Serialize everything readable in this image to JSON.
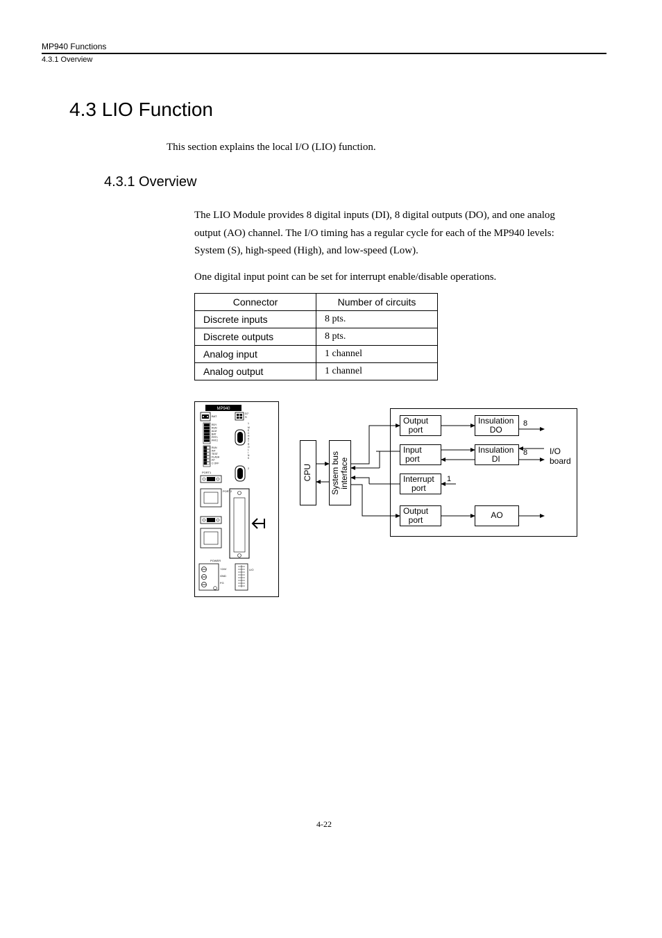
{
  "header": {
    "doc_title": "MP940 Functions",
    "running": "4.3.1  Overview"
  },
  "section": {
    "num_title": "4.3  LIO Function",
    "intro": "This section explains the local I/O (LIO) function."
  },
  "subsec": {
    "num_title": "4.3.1  Overview",
    "para1": "The LIO Module provides 8 digital inputs (DI), 8 digital outputs (DO), and one analog output (AO) channel. The I/O timing has a regular cycle for each of the MP940 levels: System (S), high-speed (High), and low-speed (Low).",
    "para2": "One digital input point can be set for interrupt enable/disable operations."
  },
  "table": {
    "head_connector": "Connector",
    "head_circuits": "Number of circuits",
    "rows": [
      {
        "c": "Discrete inputs",
        "n": "8 pts."
      },
      {
        "c": "Discrete outputs",
        "n": "8 pts."
      },
      {
        "c": "Analog input",
        "n": "1 channel"
      },
      {
        "c": "Analog output",
        "n": "1 channel"
      }
    ]
  },
  "module": {
    "title": "MP940",
    "led_labels": [
      "RDY",
      "RUN",
      "ALM",
      "BAT",
      "PRT1",
      "PRT2"
    ],
    "sw_labels": [
      "RUN",
      "INT",
      "TEST",
      "FLASH",
      "PP",
      "C OFF"
    ],
    "port1": "PORT1",
    "port2": "PORT2",
    "vert_label": "MECHATROLINK",
    "power": "POWER",
    "pow_pins": [
      "+24V",
      "GND",
      "FG"
    ],
    "lio": "LIO",
    "bat_top": "BAT",
    "d7s": "D7S"
  },
  "diagram": {
    "cpu": "CPU",
    "sysbus": "System bus\ninterface",
    "out_port1": "Output\nport",
    "in_port": "Input\nport",
    "int_port": "Interrupt\nport",
    "out_port2": "Output\nport",
    "ins_do": "Insulation\nDO",
    "ins_di": "Insulation\nDI",
    "ao": "AO",
    "io_board": "I/O\nboard",
    "n8a": "8",
    "n8b": "8",
    "n1": "1"
  },
  "footer": {
    "page": "4-22"
  }
}
